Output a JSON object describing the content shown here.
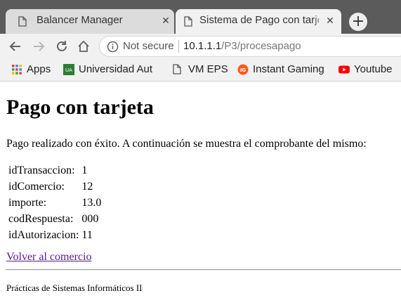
{
  "browser": {
    "tabs": [
      {
        "title": "Balancer Manager",
        "close": "✕",
        "active": false
      },
      {
        "title": "Sistema de Pago con tarjeta",
        "close": "✕",
        "active": true
      }
    ],
    "new_tab": "+",
    "security_label": "Not secure",
    "url_host": "10.1.1.1",
    "url_path": "/P3/procesapago",
    "bookmarks": [
      {
        "label": "Apps",
        "icon": "apps-grid-icon"
      },
      {
        "label": "Universidad Aut",
        "icon": "university-icon"
      },
      {
        "label": "VM EPS",
        "icon": "page-icon"
      },
      {
        "label": "Instant Gaming",
        "icon": "instant-gaming-icon"
      },
      {
        "label": "Youtube",
        "icon": "youtube-icon"
      }
    ],
    "colors": {
      "tabbar": "#5b5b5b",
      "toolbar": "#f1f1f1",
      "link_visited": "#551a8b"
    }
  },
  "page": {
    "heading": "Pago con tarjeta",
    "message": "Pago realizado con éxito. A continuación se muestra el comprobante del mismo:",
    "receipt": [
      {
        "label": "idTransaccion:",
        "value": "1"
      },
      {
        "label": "idComercio:",
        "value": "12"
      },
      {
        "label": "importe:",
        "value": "13.0"
      },
      {
        "label": "codRespuesta:",
        "value": "000"
      },
      {
        "label": "idAutorizacion:",
        "value": "11"
      }
    ],
    "back_link": "Volver al comercio",
    "footer": "Prácticas de Sistemas Informáticos II"
  }
}
